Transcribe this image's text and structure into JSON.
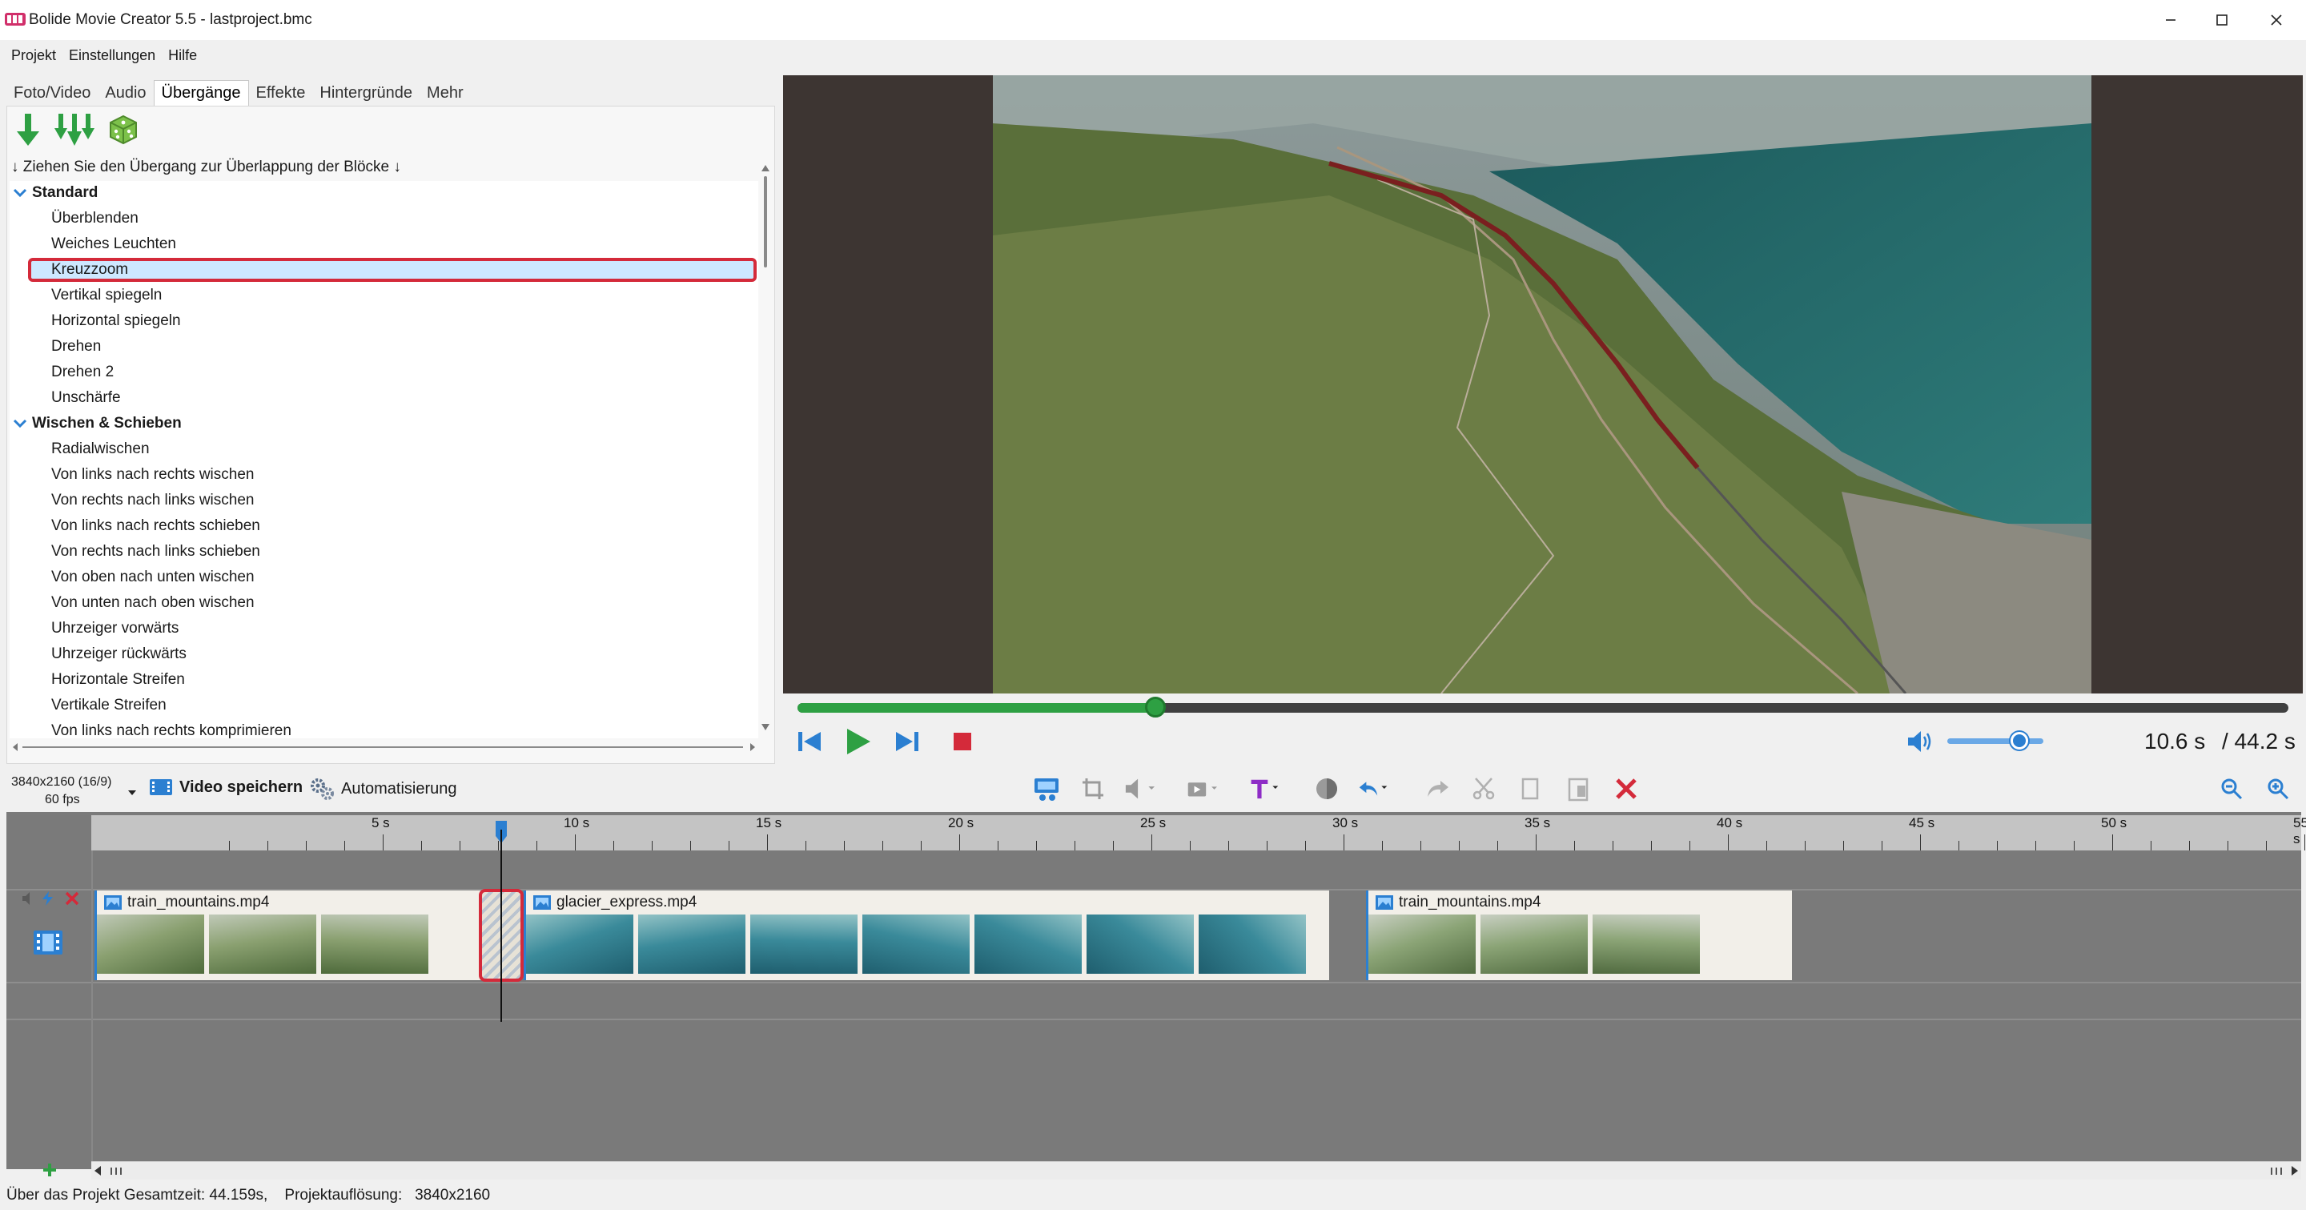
{
  "window": {
    "title": "Bolide Movie Creator 5.5 - lastproject.bmc"
  },
  "menu": [
    "Projekt",
    "Einstellungen",
    "Hilfe"
  ],
  "tabs": [
    {
      "label": "Foto/Video",
      "active": false
    },
    {
      "label": "Audio",
      "active": false
    },
    {
      "label": "Übergänge",
      "active": true
    },
    {
      "label": "Effekte",
      "active": false
    },
    {
      "label": "Hintergründe",
      "active": false
    },
    {
      "label": "Mehr",
      "active": false
    }
  ],
  "panel": {
    "hint": "↓ Ziehen Sie den Übergang zur Überlappung der Blöcke ↓",
    "groups": [
      {
        "label": "Standard",
        "items": [
          "Überblenden",
          "Weiches Leuchten",
          "Kreuzzoom",
          "Vertikal spiegeln",
          "Horizontal spiegeln",
          "Drehen",
          "Drehen 2",
          "Unschärfe"
        ]
      },
      {
        "label": "Wischen & Schieben",
        "items": [
          "Radialwischen",
          "Von links nach rechts wischen",
          "Von rechts nach links wischen",
          "Von links nach rechts schieben",
          "Von rechts nach links schieben",
          "Von oben nach unten wischen",
          "Von unten nach oben wischen",
          "Uhrzeiger vorwärts",
          "Uhrzeiger rückwärts",
          "Horizontale Streifen",
          "Vertikale Streifen",
          "Von links nach rechts komprimieren"
        ]
      }
    ],
    "selected": "Kreuzzoom"
  },
  "player": {
    "time_current": "10.6 s",
    "time_total": "/ 44.2 s",
    "progress": 0.24,
    "volume": 0.75
  },
  "project": {
    "resolution": "3840x2160 (16/9)",
    "fps": "60 fps",
    "save_label": "Video speichern",
    "automation_label": "Automatisierung"
  },
  "timeline": {
    "ticks": [
      "5 s",
      "10 s",
      "15 s",
      "20 s",
      "25 s",
      "30 s",
      "35 s",
      "40 s",
      "45 s",
      "50 s",
      "55 s"
    ],
    "clips": [
      {
        "name": "train_mountains.mp4",
        "thumbs": 3
      },
      {
        "name": "glacier_express.mp4",
        "thumbs": 7
      },
      {
        "name": "train_mountains.mp4",
        "thumbs": 3
      }
    ]
  },
  "status": {
    "text": "Über das Projekt Gesamtzeit: 44.159s,    Projektauflösung:   3840x2160"
  },
  "colors": {
    "accent": "#2b7fd1",
    "seek": "#2ea043",
    "highlight": "#d42a3a",
    "selection": "#cde8ff"
  }
}
